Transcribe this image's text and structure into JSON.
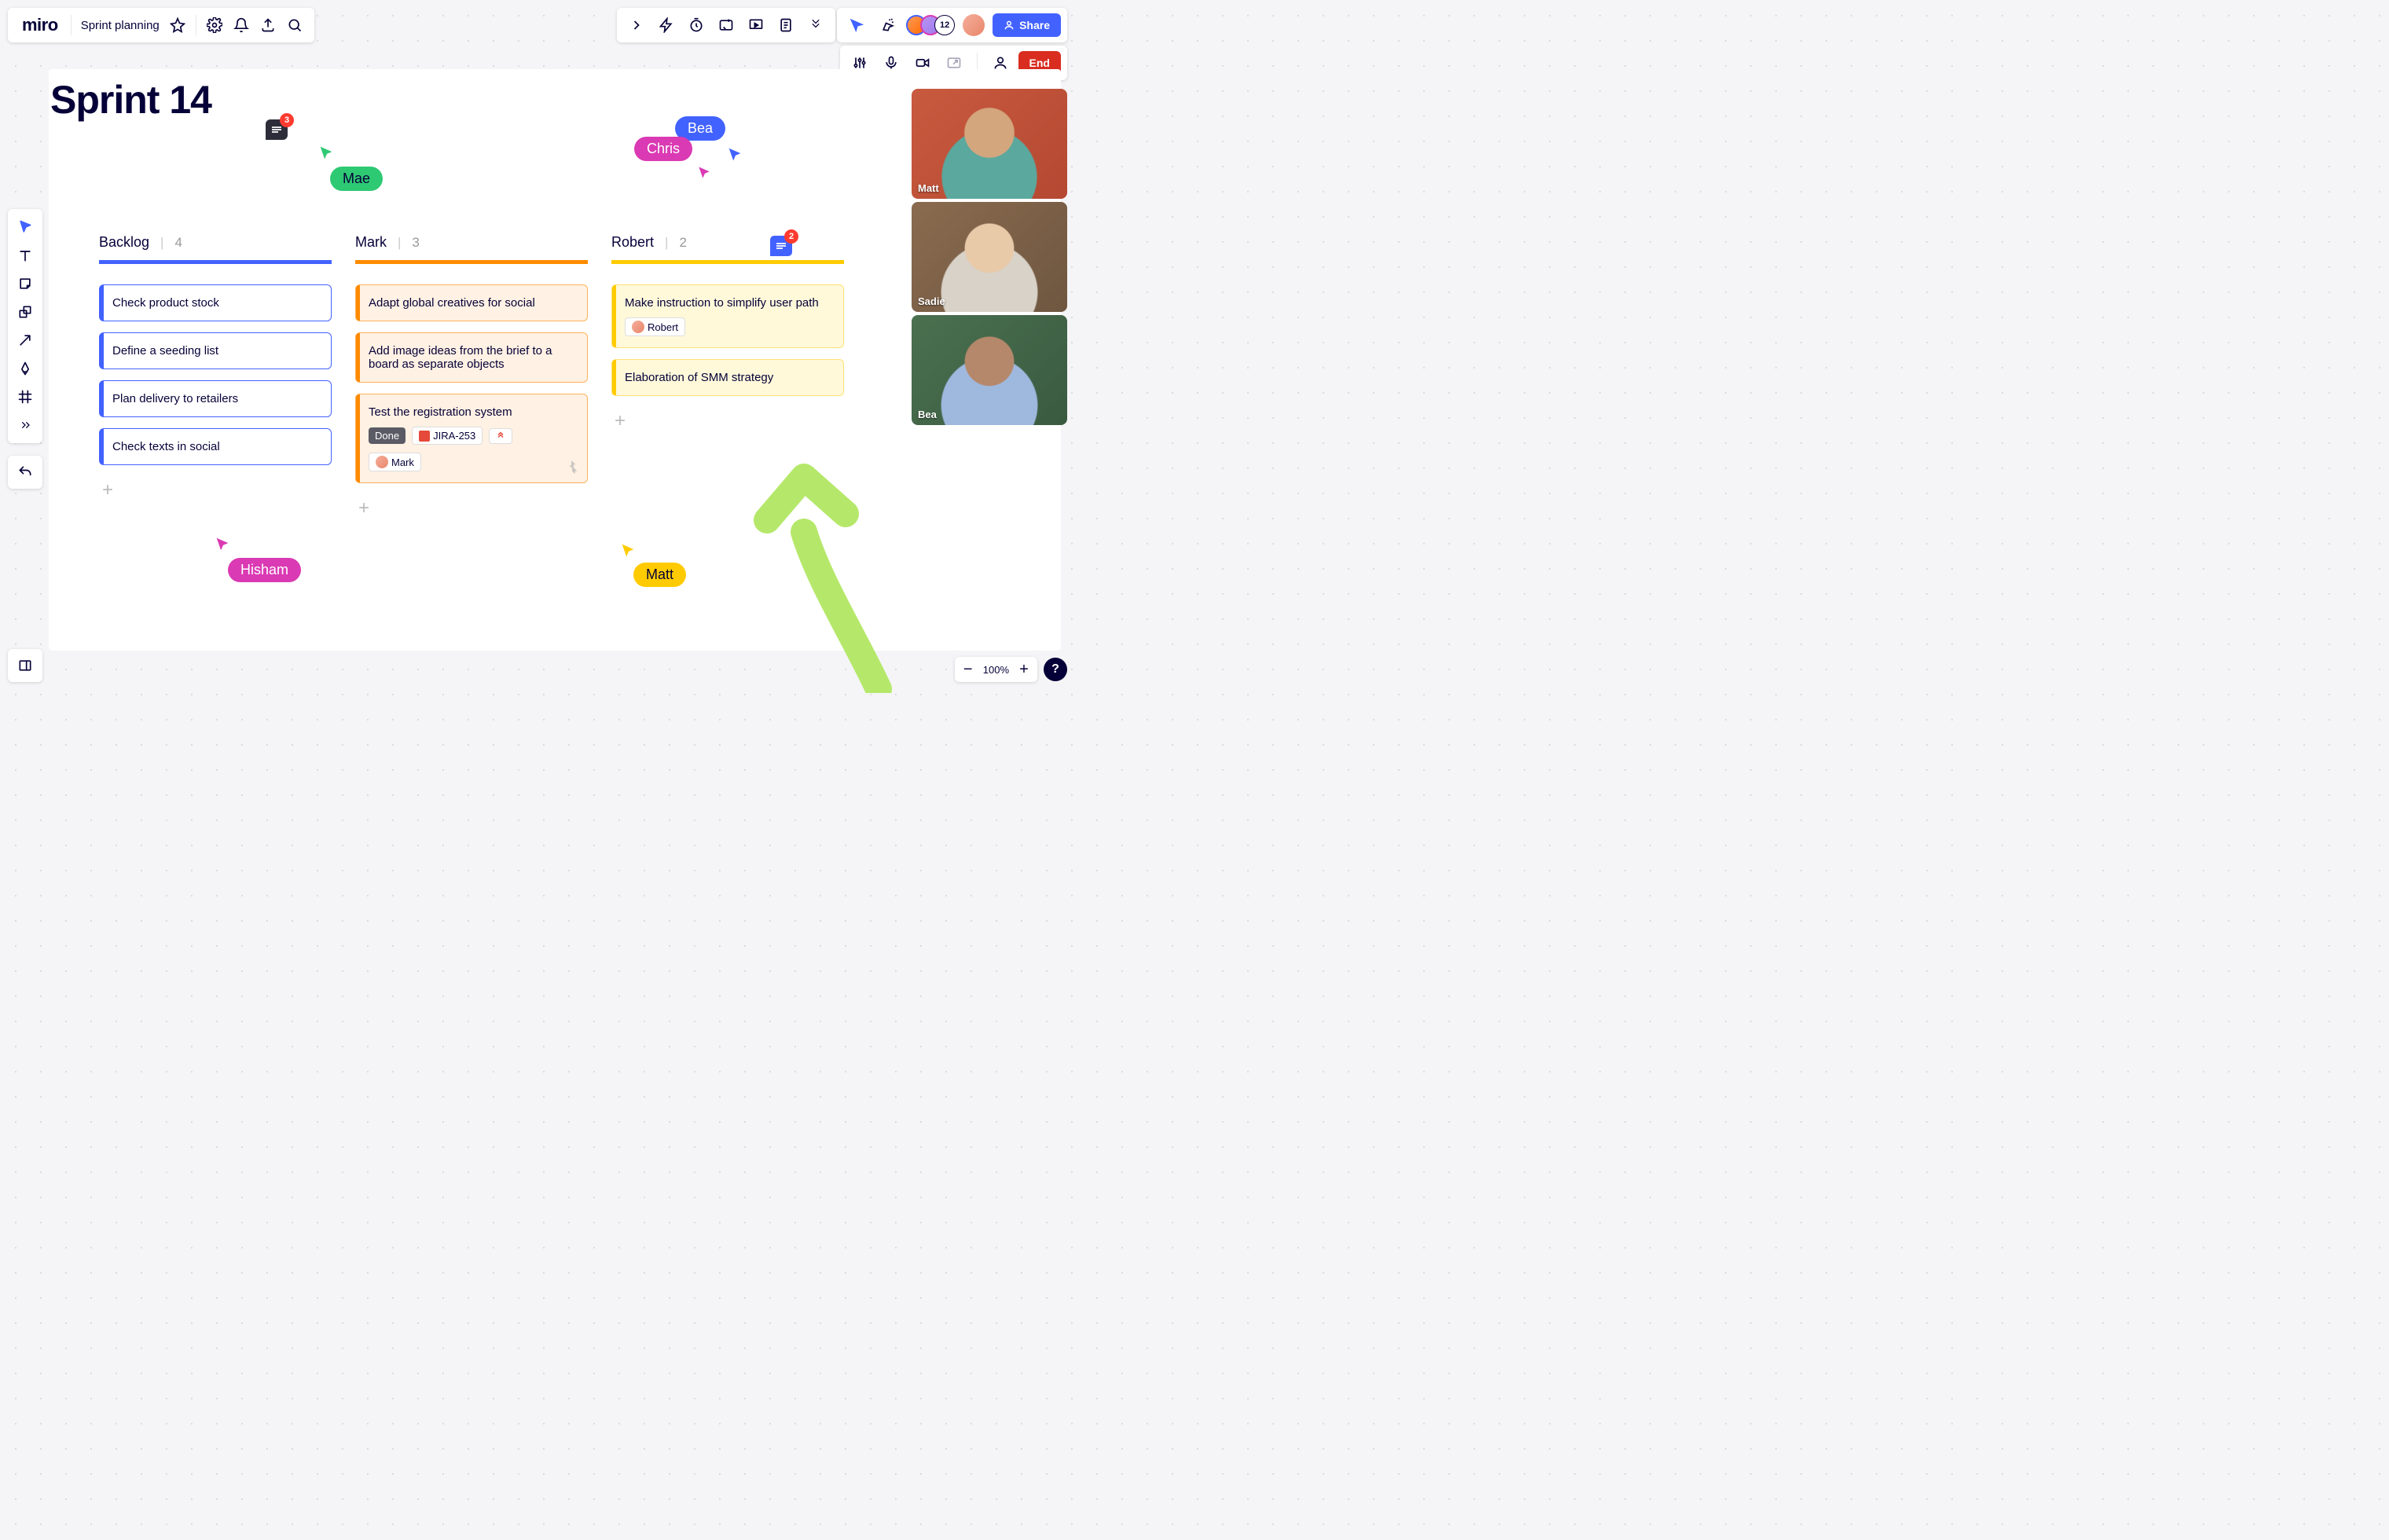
{
  "header": {
    "logo": "miro",
    "board_name": "Sprint planning"
  },
  "share_label": "Share",
  "end_label": "End",
  "avatar_overflow": "12",
  "zoom": "100%",
  "board_title": "Sprint 14",
  "comment_badge_a": "3",
  "comment_badge_b": "2",
  "cursors": {
    "mae": "Mae",
    "bea": "Bea",
    "chris": "Chris",
    "hisham": "Hisham",
    "matt": "Matt"
  },
  "columns": [
    {
      "name": "Backlog",
      "count": "4",
      "cards": [
        {
          "text": "Check product stock"
        },
        {
          "text": "Define a seeding list"
        },
        {
          "text": "Plan delivery to retailers"
        },
        {
          "text": "Check texts in social"
        }
      ]
    },
    {
      "name": "Mark",
      "count": "3",
      "cards": [
        {
          "text": "Adapt global creatives for social"
        },
        {
          "text": "Add image ideas from the brief to a board as separate objects"
        },
        {
          "text": "Test the registration system",
          "done": "Done",
          "jira": "JIRA-253",
          "assignee": "Mark"
        }
      ]
    },
    {
      "name": "Robert",
      "count": "2",
      "cards": [
        {
          "text": "Make instruction to simplify user path",
          "assignee": "Robert"
        },
        {
          "text": "Elaboration of SMM strategy"
        }
      ]
    }
  ],
  "video": {
    "matt": "Matt",
    "sadie": "Sadie",
    "bea": "Bea"
  }
}
